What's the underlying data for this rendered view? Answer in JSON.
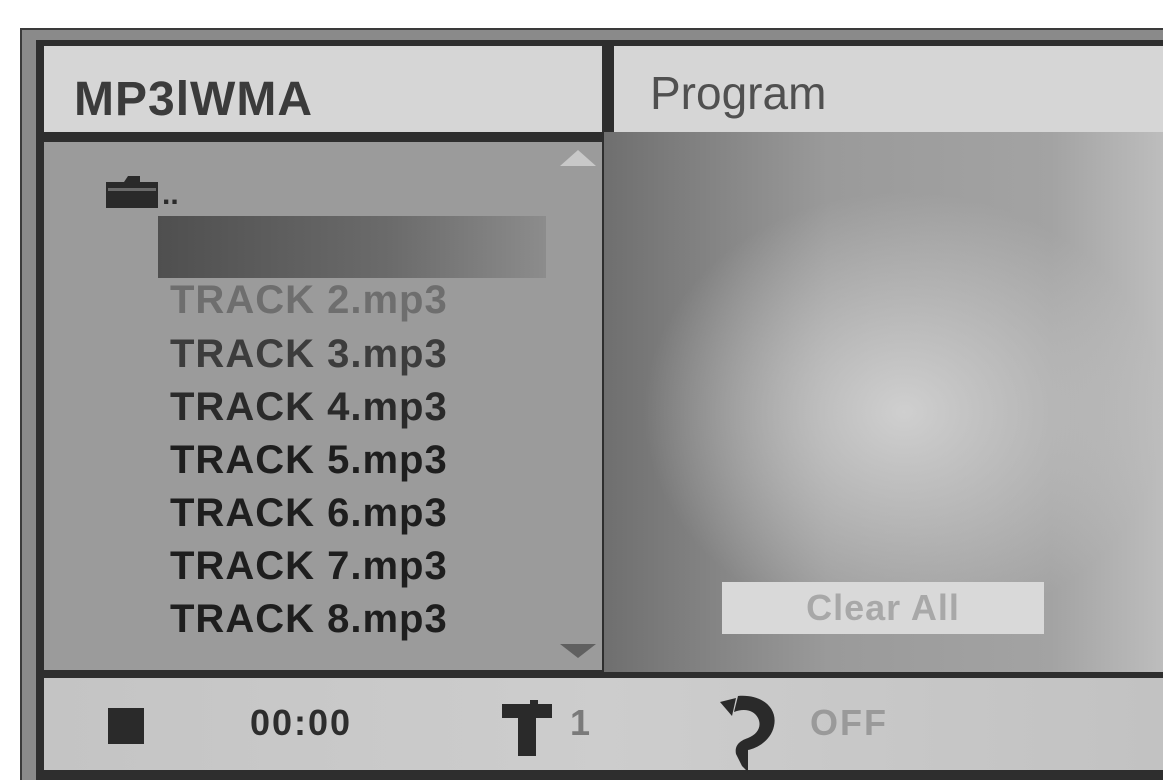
{
  "header": {
    "left_title": "MP3lWMA",
    "right_title": "Program"
  },
  "file_list": {
    "parent_folder_label": "..",
    "tracks": [
      "TRACK 2.mp3",
      "TRACK 3.mp3",
      "TRACK 4.mp3",
      "TRACK 5.mp3",
      "TRACK 6.mp3",
      "TRACK 7.mp3",
      "TRACK 8.mp3"
    ]
  },
  "program": {
    "clear_all_label": "Clear All"
  },
  "status": {
    "playback_icon": "stop-icon",
    "time": "00:00",
    "title_number": "1",
    "repeat_state": "OFF"
  }
}
